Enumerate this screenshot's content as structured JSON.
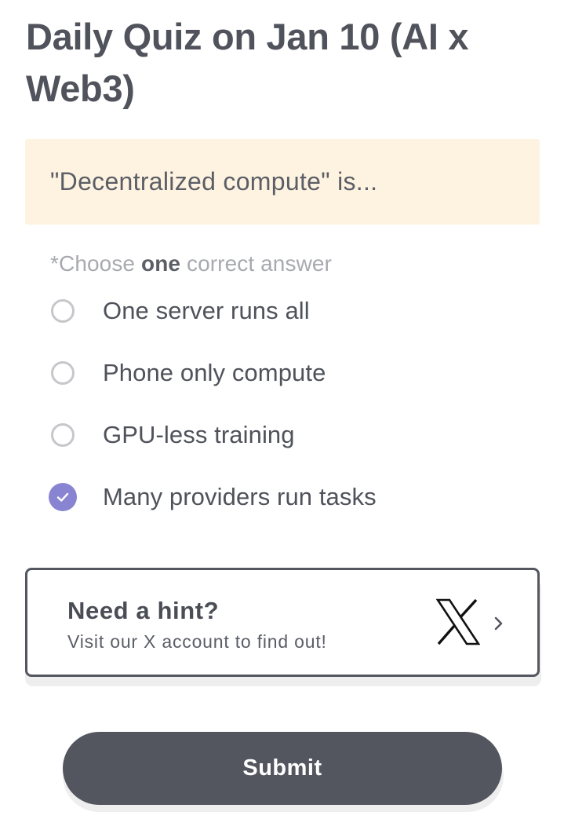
{
  "quiz": {
    "title": "Daily Quiz on Jan 10 (AI x Web3)",
    "question": "\"Decentralized compute\" is...",
    "instruction": {
      "prefix": "*Choose ",
      "emphasis": "one",
      "suffix": " correct answer"
    },
    "options": [
      {
        "label": "One server runs all",
        "selected": false
      },
      {
        "label": "Phone only compute",
        "selected": false
      },
      {
        "label": "GPU-less training",
        "selected": false
      },
      {
        "label": "Many providers run tasks",
        "selected": true
      }
    ]
  },
  "hint": {
    "title": "Need a hint?",
    "subtitle": "Visit our X account to find out!",
    "icon": "x-logo-icon"
  },
  "submit": {
    "label": "Submit"
  },
  "colors": {
    "accent": "#8884d2",
    "question_bg": "#fef3e0",
    "button_bg": "#53565f"
  }
}
